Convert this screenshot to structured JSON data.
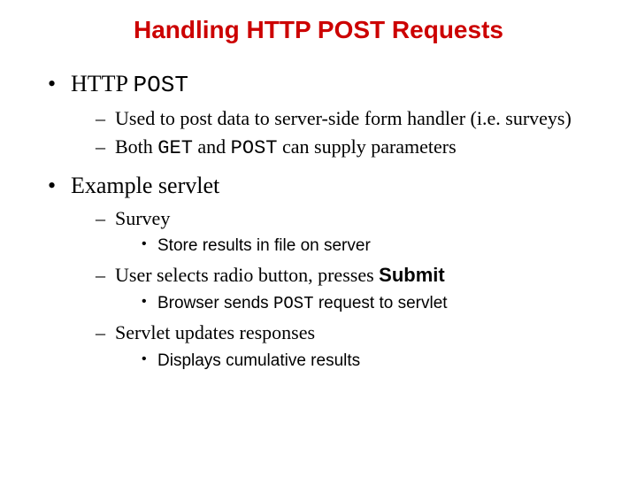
{
  "title_color": "#cc0000",
  "title": "Handling HTTP POST Requests",
  "bullets": {
    "b1": {
      "pre": "HTTP ",
      "code": "POST"
    },
    "b1_subs": {
      "s1": "Used to post data to server-side form handler (i.e. surveys)",
      "s2": {
        "a": "Both ",
        "c1": "GET",
        "b": " and ",
        "c2": "POST",
        "d": " can supply parameters"
      }
    },
    "b2": "Example servlet",
    "b2_subs": {
      "s1": "Survey",
      "s1_subs": {
        "t1": "Store results in file on server"
      },
      "s2": {
        "a": "User selects radio button, presses ",
        "sb": "Submit"
      },
      "s2_subs": {
        "t1": {
          "a": "Browser sends ",
          "code": "POST",
          "b": " request to servlet"
        }
      },
      "s3": "Servlet updates responses",
      "s3_subs": {
        "t1": "Displays cumulative results"
      }
    }
  }
}
